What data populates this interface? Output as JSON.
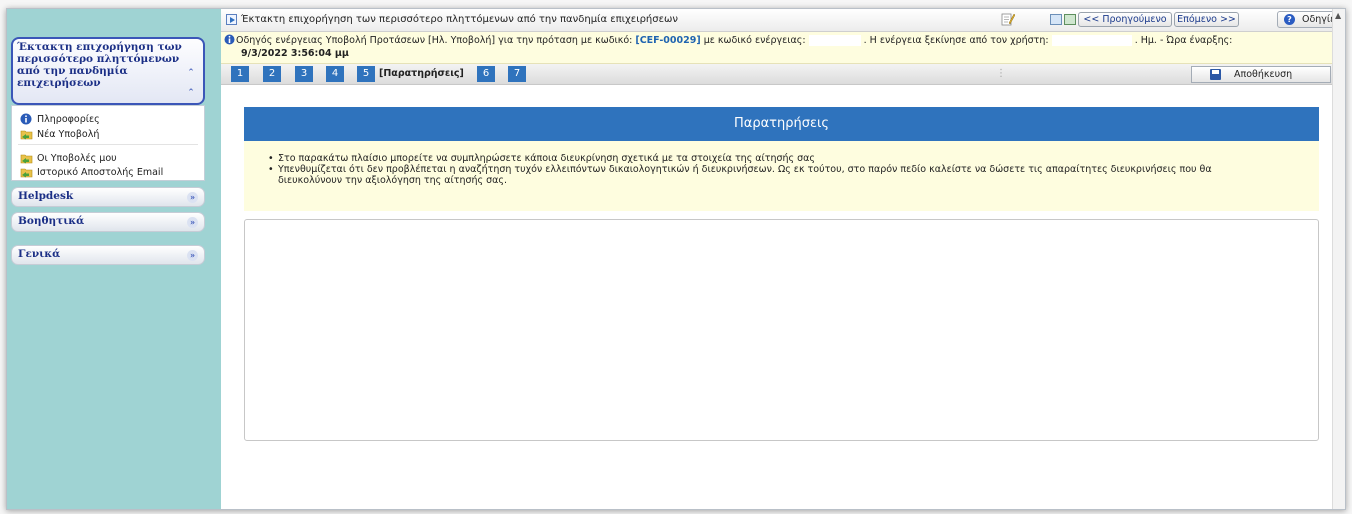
{
  "sidebar": {
    "active_panel": {
      "title": "Έκτακτη επιχορήγηση των περισσότερο πληττόμενων από την πανδημία επιχειρήσεων"
    },
    "menu": [
      {
        "label": "Πληροφορίες",
        "icon": "info-icon"
      },
      {
        "label": "Νέα Υποβολή",
        "icon": "folder-arrow-icon"
      },
      {
        "label": "Οι Υποβολές μου",
        "icon": "folder-arrow-icon"
      },
      {
        "label": "Ιστορικό Αποστολής Email",
        "icon": "folder-arrow-icon"
      }
    ],
    "sections": [
      {
        "label": "Helpdesk"
      },
      {
        "label": "Βοηθητικά"
      },
      {
        "label": "Γενικά"
      }
    ]
  },
  "topbar": {
    "title": "Έκτακτη επιχορήγηση των περισσότερο πληττόμενων από την πανδημία επιχειρήσεων",
    "prev_label": "<< Προηγούμενο",
    "next_label": "Επόμενο >>",
    "help_label": "Οδηγίες"
  },
  "info": {
    "prefix": "Οδηγός ενέργειας Υποβολή Προτάσεων [Ηλ. Υποβολή] για την πρόταση με κωδικό:",
    "code": "[CEF-00029]",
    "middle": "με κωδικό ενέργειας:",
    "user_text": ". Η ενέργεια ξεκίνησε από τον χρήστη:",
    "date_label": ". Ημ. - Ώρα έναρξης:",
    "date_value": "9/3/2022 3:56:04 μμ"
  },
  "steps": {
    "items": [
      "1",
      "2",
      "3",
      "4",
      "5",
      "6",
      "7"
    ],
    "current_label": "[Παρατηρήσεις]",
    "save_label": "Αποθήκευση"
  },
  "section": {
    "title": "Παρατηρήσεις",
    "notes": [
      "Στο παρακάτω πλαίσιο μπορείτε να συμπληρώσετε κάποια διευκρίνηση σχετικά με τα στοιχεία της αίτησής σας",
      "Υπενθυμίζεται ότι δεν προβλέπεται η αναζήτηση τυχόν ελλειπόντων δικαιολογητικών ή διευκρινήσεων. Ως εκ τούτου, στο παρόν πεδίο καλείστε να δώσετε τις απαραίτητες διευκρινήσεις που θα",
      "διευκολύνουν την αξιολόγηση της αίτησής σας."
    ],
    "textarea_value": ""
  },
  "colors": {
    "accent": "#2f73bd",
    "sidebar_bg": "#9fd3d3",
    "info_bg": "#fefddf",
    "panel_title": "#1b2f86"
  }
}
